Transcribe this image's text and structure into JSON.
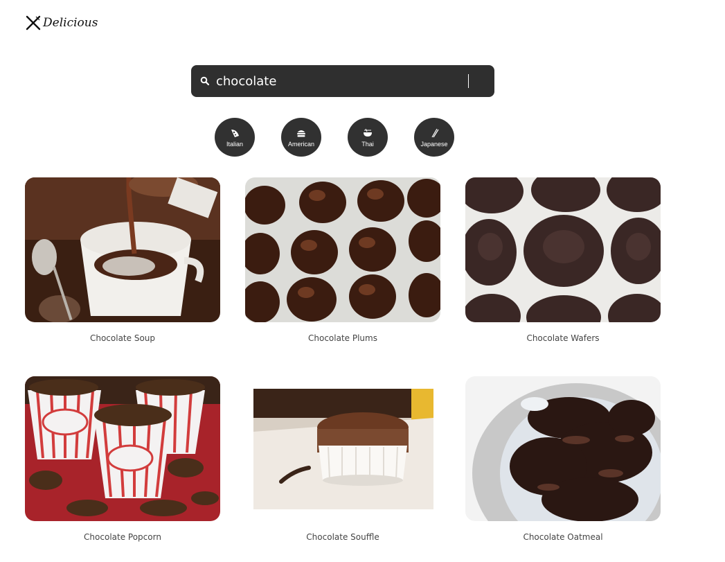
{
  "brand": {
    "name": "Delicious",
    "icon": "crossed-utensils-icon"
  },
  "search": {
    "value": "chocolate",
    "icon": "search-icon"
  },
  "cuisines": [
    {
      "label": "Italian",
      "icon": "pizza-icon"
    },
    {
      "label": "American",
      "icon": "burger-icon"
    },
    {
      "label": "Thai",
      "icon": "noodle-bowl-icon"
    },
    {
      "label": "Japanese",
      "icon": "chopsticks-icon"
    }
  ],
  "recipes": [
    {
      "title": "Chocolate Soup"
    },
    {
      "title": "Chocolate Plums"
    },
    {
      "title": "Chocolate Wafers"
    },
    {
      "title": "Chocolate Popcorn"
    },
    {
      "title": "Chocolate Souffle"
    },
    {
      "title": "Chocolate Oatmeal"
    }
  ],
  "colors": {
    "search_bg": "#2f2f2f",
    "pill_bg": "#313131",
    "text": "#444444"
  }
}
